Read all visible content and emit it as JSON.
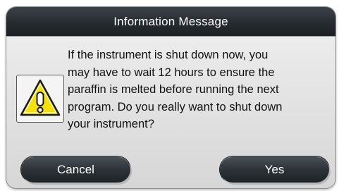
{
  "dialog": {
    "title": "Information Message",
    "message_lines": [
      "If the instrument is shut down now, you",
      "may have to wait 12 hours to ensure the",
      "paraffin is melted before running the next",
      "program. Do you really want to shut down",
      "your instrument?"
    ],
    "icon": "warning-icon",
    "icon_color": "#f5e100",
    "buttons": {
      "cancel_label": "Cancel",
      "yes_label": "Yes"
    }
  }
}
